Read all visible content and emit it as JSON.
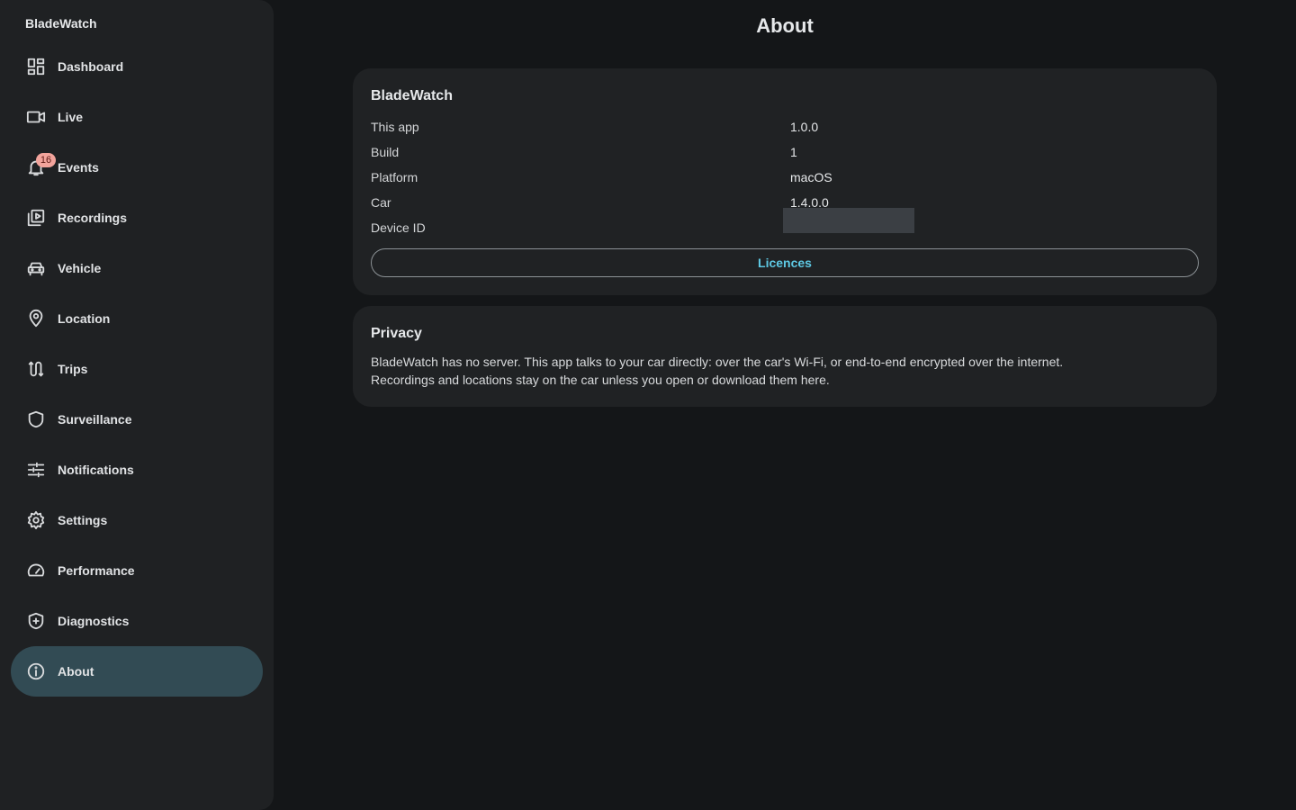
{
  "app": {
    "name": "BladeWatch"
  },
  "sidebar": {
    "items": [
      {
        "label": "Dashboard",
        "icon": "dashboard-icon"
      },
      {
        "label": "Live",
        "icon": "videocam-icon"
      },
      {
        "label": "Events",
        "icon": "bell-icon",
        "badge": "16"
      },
      {
        "label": "Recordings",
        "icon": "video-library-icon"
      },
      {
        "label": "Vehicle",
        "icon": "car-icon"
      },
      {
        "label": "Location",
        "icon": "location-pin-icon"
      },
      {
        "label": "Trips",
        "icon": "route-icon"
      },
      {
        "label": "Surveillance",
        "icon": "shield-icon"
      },
      {
        "label": "Notifications",
        "icon": "tune-icon"
      },
      {
        "label": "Settings",
        "icon": "gear-icon"
      },
      {
        "label": "Performance",
        "icon": "speedometer-icon"
      },
      {
        "label": "Diagnostics",
        "icon": "health-shield-icon"
      },
      {
        "label": "About",
        "icon": "info-icon",
        "active": true
      }
    ]
  },
  "page": {
    "title": "About"
  },
  "about_card": {
    "title": "BladeWatch",
    "rows": [
      {
        "label": "This app",
        "value": "1.0.0"
      },
      {
        "label": "Build",
        "value": "1"
      },
      {
        "label": "Platform",
        "value": "macOS"
      },
      {
        "label": "Car",
        "value": "1.4.0.0"
      },
      {
        "label": "Device ID",
        "value": ""
      }
    ],
    "licences_label": "Licences"
  },
  "privacy_card": {
    "title": "Privacy",
    "line1": "BladeWatch has no server. This app talks to your car directly: over the car's Wi-Fi, or end-to-end encrypted over the internet.",
    "line2": "Recordings and locations stay on the car unless you open or download them here."
  },
  "colors": {
    "background": "#141618",
    "sidebar": "#1f2123",
    "card": "#202224",
    "active_nav": "#324b54",
    "accent": "#5ec9e4",
    "badge": "#f2a49c"
  }
}
